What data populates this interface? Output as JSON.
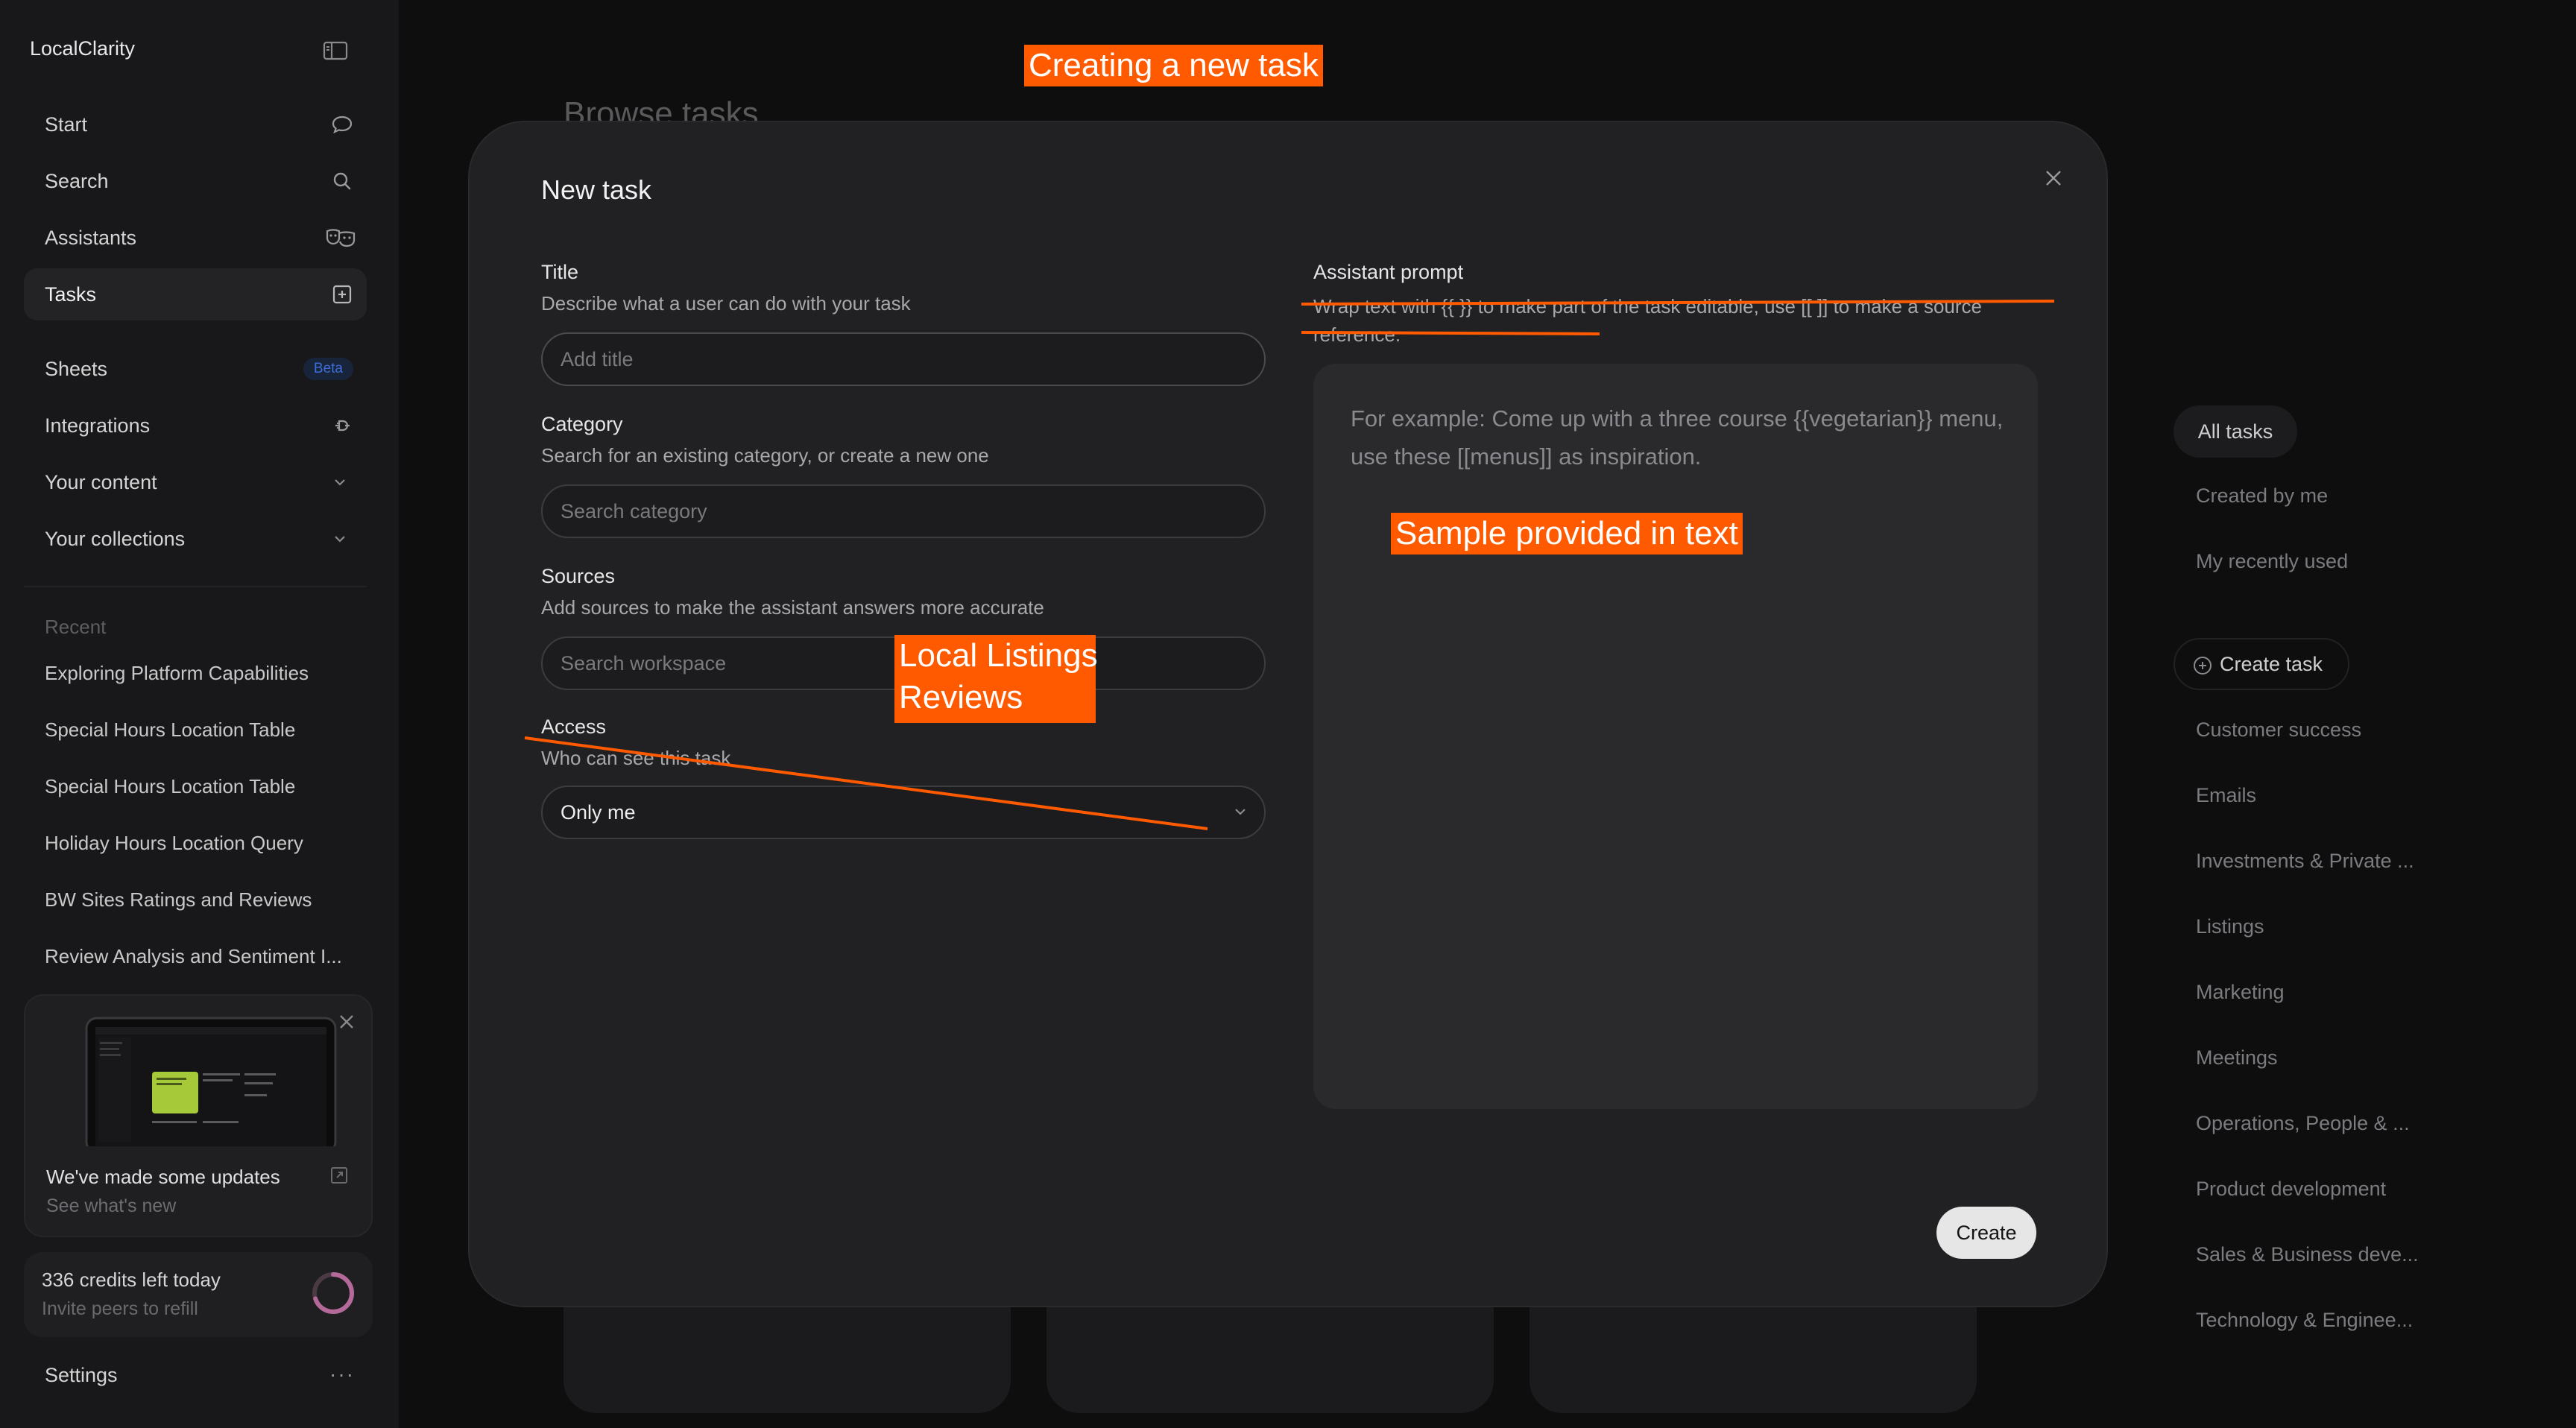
{
  "app": {
    "name": "LocalClarity"
  },
  "sidebar": {
    "nav": [
      {
        "label": "Start",
        "icon": "chat-bubble-icon"
      },
      {
        "label": "Search",
        "icon": "search-icon"
      },
      {
        "label": "Assistants",
        "icon": "masks-icon"
      },
      {
        "label": "Tasks",
        "icon": "task-plus-icon",
        "active": true
      },
      {
        "label": "Sheets",
        "badge": "Beta"
      },
      {
        "label": "Integrations",
        "icon": "plug-icon"
      },
      {
        "label": "Your content",
        "icon": "chevron-down-icon"
      },
      {
        "label": "Your collections",
        "icon": "chevron-down-icon"
      }
    ],
    "recent_heading": "Recent",
    "recent": [
      "Exploring Platform Capabilities",
      "Special Hours Location Table",
      "Special Hours Location Table",
      "Holiday Hours Location Query",
      "BW Sites Ratings and Reviews",
      "Review Analysis and Sentiment I..."
    ],
    "update_card": {
      "title": "We've made some updates",
      "subtitle": "See what's new"
    },
    "credits": {
      "title": "336 credits left today",
      "subtitle": "Invite peers to refill",
      "used_fraction": 0.7
    },
    "settings_label": "Settings",
    "more_label": "···"
  },
  "background": {
    "page_title": "Browse tasks",
    "filters": [
      "All tasks",
      "Created by me",
      "My recently used"
    ],
    "create_task_label": "Create task",
    "categories": [
      "Customer success",
      "Emails",
      "Investments & Private ...",
      "Listings",
      "Marketing",
      "Meetings",
      "Operations, People & ...",
      "Product development",
      "Sales & Business deve...",
      "Technology & Enginee..."
    ]
  },
  "modal": {
    "title": "New task",
    "title_field": {
      "label": "Title",
      "help": "Describe what a user can do with your task",
      "placeholder": "Add title",
      "value": ""
    },
    "category_field": {
      "label": "Category",
      "help": "Search for an existing category, or create a new one",
      "placeholder": "Search category"
    },
    "sources_field": {
      "label": "Sources",
      "help": "Add sources to make the assistant answers more accurate",
      "placeholder": "Search workspace"
    },
    "access_field": {
      "label": "Access",
      "help": "Who can see this task",
      "selected": "Only me"
    },
    "prompt_field": {
      "label": "Assistant prompt",
      "help": "Wrap text with {{ }} to make part of the task editable, use [[ ]] to make a source reference.",
      "placeholder": "For example: Come up with a three course {{vegetarian}} menu, use these [[menus]] as inspiration."
    },
    "create_label": "Create"
  },
  "annotations": {
    "creating_task": "Creating a new task",
    "sample_text": "Sample provided in text",
    "local_listings": "Local Listings",
    "reviews": "Reviews",
    "color": "#ff5a00"
  }
}
